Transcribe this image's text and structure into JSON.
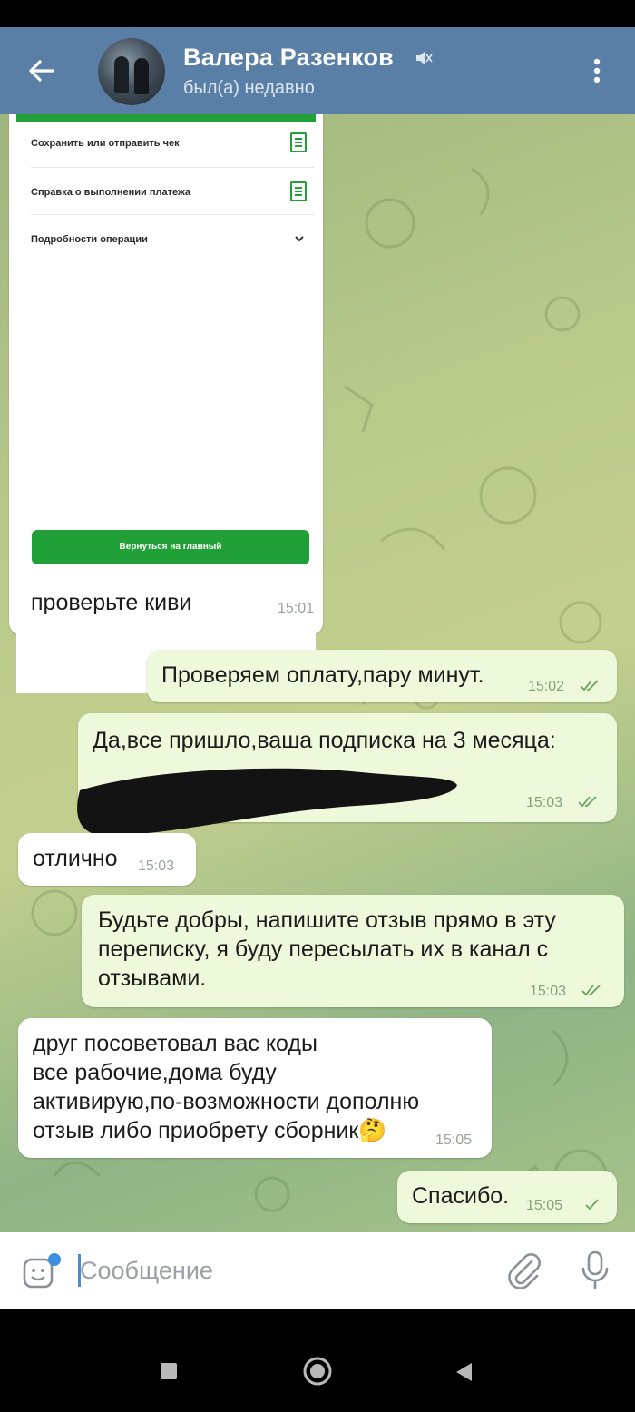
{
  "header": {
    "contact_name": "Валера Разенков",
    "status": "был(а) недавно",
    "back_icon": "arrow-left-icon",
    "menu_icon": "more-vertical-icon",
    "mute_icon": "muted-speaker-icon"
  },
  "receipt": {
    "save_label": "Сохранить или отправить чек",
    "certificate_label": "Справка о выполнении платежа",
    "details_label": "Подробности операции",
    "home_button": "Вернуться на главный",
    "accent_color": "#21a038"
  },
  "messages": [
    {
      "direction": "in",
      "text": "проверьте киви",
      "time": "15:01"
    },
    {
      "direction": "out",
      "text": "Проверяем оплату,пару минут.",
      "time": "15:02",
      "status": "read"
    },
    {
      "direction": "out",
      "text": "Да,все пришло,ваша подписка на 3 месяца:",
      "time": "15:03",
      "status": "read",
      "redacted": true
    },
    {
      "direction": "in",
      "text": "отлично",
      "time": "15:03"
    },
    {
      "direction": "out",
      "lines": [
        "Будьте добры, напишите отзыв прямо в эту",
        "переписку, я буду пересылать их в канал с",
        "отзывами."
      ],
      "time": "15:03",
      "status": "read"
    },
    {
      "direction": "in",
      "lines": [
        "друг посоветовал вас коды",
        "все рабочие,дома буду",
        "активирую,по-возможности дополню",
        "отзыв либо приобрету сборник🤔"
      ],
      "time": "15:05"
    },
    {
      "direction": "out",
      "text": "Спасибо.",
      "time": "15:05",
      "status": "sent"
    }
  ],
  "composer": {
    "placeholder": "Сообщение",
    "emoji_icon": "sticker-emoji-icon",
    "attach_icon": "paperclip-icon",
    "mic_icon": "microphone-icon"
  },
  "colors": {
    "header_bg": "#5a7fa6",
    "incoming_bubble": "#ffffff",
    "outgoing_bubble": "#eef9dc",
    "read_check": "#6aa35e"
  }
}
